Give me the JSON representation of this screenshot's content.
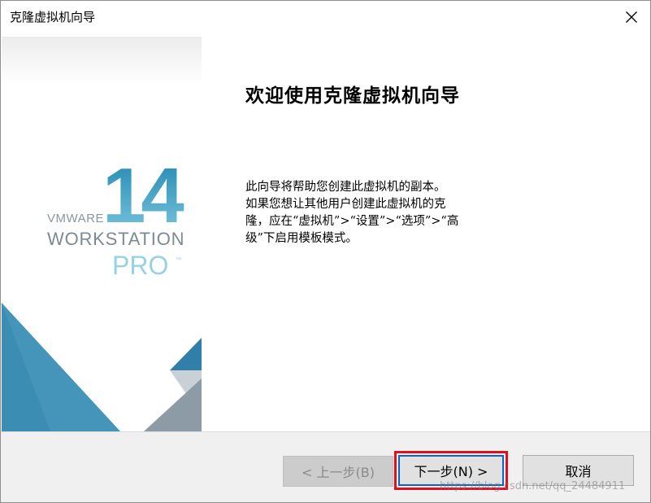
{
  "window": {
    "title": "克隆虚拟机向导",
    "close_icon": "close-icon"
  },
  "branding": {
    "version": "14",
    "vendor": "VMWARE",
    "product": "WORKSTATION",
    "edition": "PRO",
    "trademark": "™",
    "colors": {
      "number_top": "#2b8fb6",
      "number_bottom": "#78c7dd",
      "text_gray": "#7d8a93",
      "edition_blue": "#8fd0e3",
      "triangle_blue": "#3b8db4",
      "triangle_gray": "#8a9aa4"
    }
  },
  "content": {
    "heading": "欢迎使用克隆虚拟机向导",
    "description_lines": [
      "此向导将帮助您创建此虚拟机的副本。",
      "如果您想让其他用户创建此虚拟机的克",
      "隆，应在“虚拟机”>“设置”>“选项”>“高",
      "级”下启用模板模式。"
    ]
  },
  "footer": {
    "back_label": "< 上一步(B)",
    "next_label": "下一步(N) >",
    "cancel_label": "取消",
    "watermark": "https://blog.csdn.net/qq_24484911",
    "highlight_color": "#e0101f",
    "focus_color": "#0a64c8"
  }
}
